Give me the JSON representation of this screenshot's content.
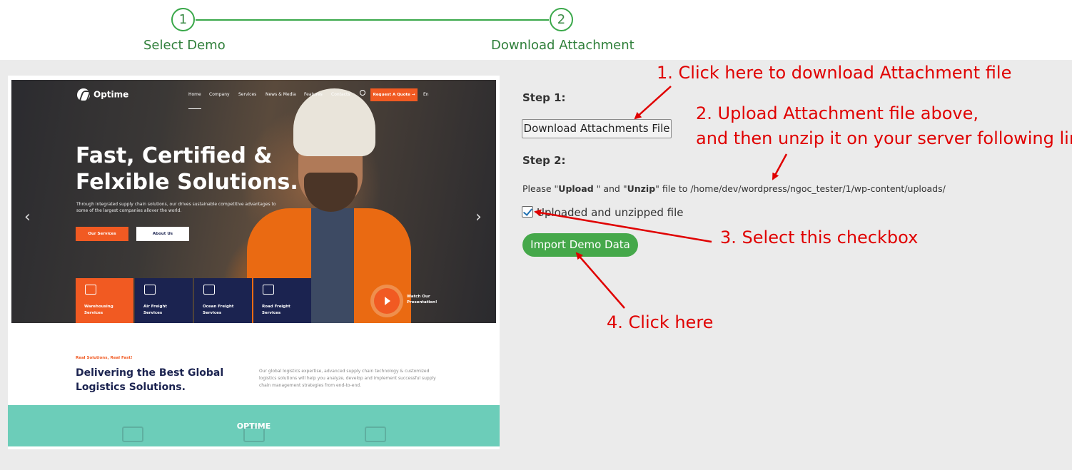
{
  "stepper": {
    "steps": [
      {
        "number": "1",
        "label": "Select Demo"
      },
      {
        "number": "2",
        "label": "Download Attachment"
      }
    ]
  },
  "preview": {
    "brand": "Optime",
    "nav": [
      "Home",
      "Company",
      "Services",
      "News & Media",
      "Features",
      "Contacts"
    ],
    "quote_button": "Request A Quote →",
    "language": "En",
    "hero_title": "Fast, Certified & Felxible Solutions.",
    "hero_subtitle": "Through integrated supply chain solutions, our drives sustainable competitive advantages to some of the largest companies allover the world.",
    "primary_button": "Our Services",
    "secondary_button": "About Us",
    "services": [
      {
        "line1": "Warehousing",
        "line2": "Services"
      },
      {
        "line1": "Air Freight",
        "line2": "Services"
      },
      {
        "line1": "Ocean Freight",
        "line2": "Services"
      },
      {
        "line1": "Road Freight",
        "line2": "Services"
      }
    ],
    "video_label_1": "Watch Our",
    "video_label_2": "Presentation!",
    "section_tag": "Real Solutions, Real Fast!",
    "section_title": "Delivering the Best Global Logistics Solutions.",
    "section_body": "Our global logistics expertise, advanced supply chain technology & customized logistics solutions will help you analyze, develop and implement successful supply chain management strategies from end-to-end.",
    "overlay_label": "OPTIME"
  },
  "panel": {
    "step1_heading": "Step 1:",
    "download_button": "Download Attachments File",
    "step2_heading": "Step 2:",
    "upload_prefix": "Please \"",
    "upload_word": "Upload",
    "upload_mid": " \" and \"",
    "unzip_word": "Unzip",
    "upload_suffix": "\" file to ",
    "upload_path": "/home/dev/wordpress/ngoc_tester/1/wp-content/uploads/",
    "checkbox_label": "Uploaded and unzipped file",
    "checkbox_checked": true,
    "import_button": "Import Demo Data"
  },
  "annotations": {
    "note1": "1. Click here to download Attachment file",
    "note2_line1": "2. Upload Attachment file above,",
    "note2_line2": "and then unzip it on your server following link",
    "note3": "3. Select this checkbox",
    "note4": "4. Click here"
  },
  "colors": {
    "stepper_green": "#3aa84a",
    "import_green": "#45a84a",
    "annotation_red": "#e00000",
    "preview_orange": "#f15a22",
    "preview_navy": "#1b2350",
    "preview_teal": "#6ccdb9"
  }
}
